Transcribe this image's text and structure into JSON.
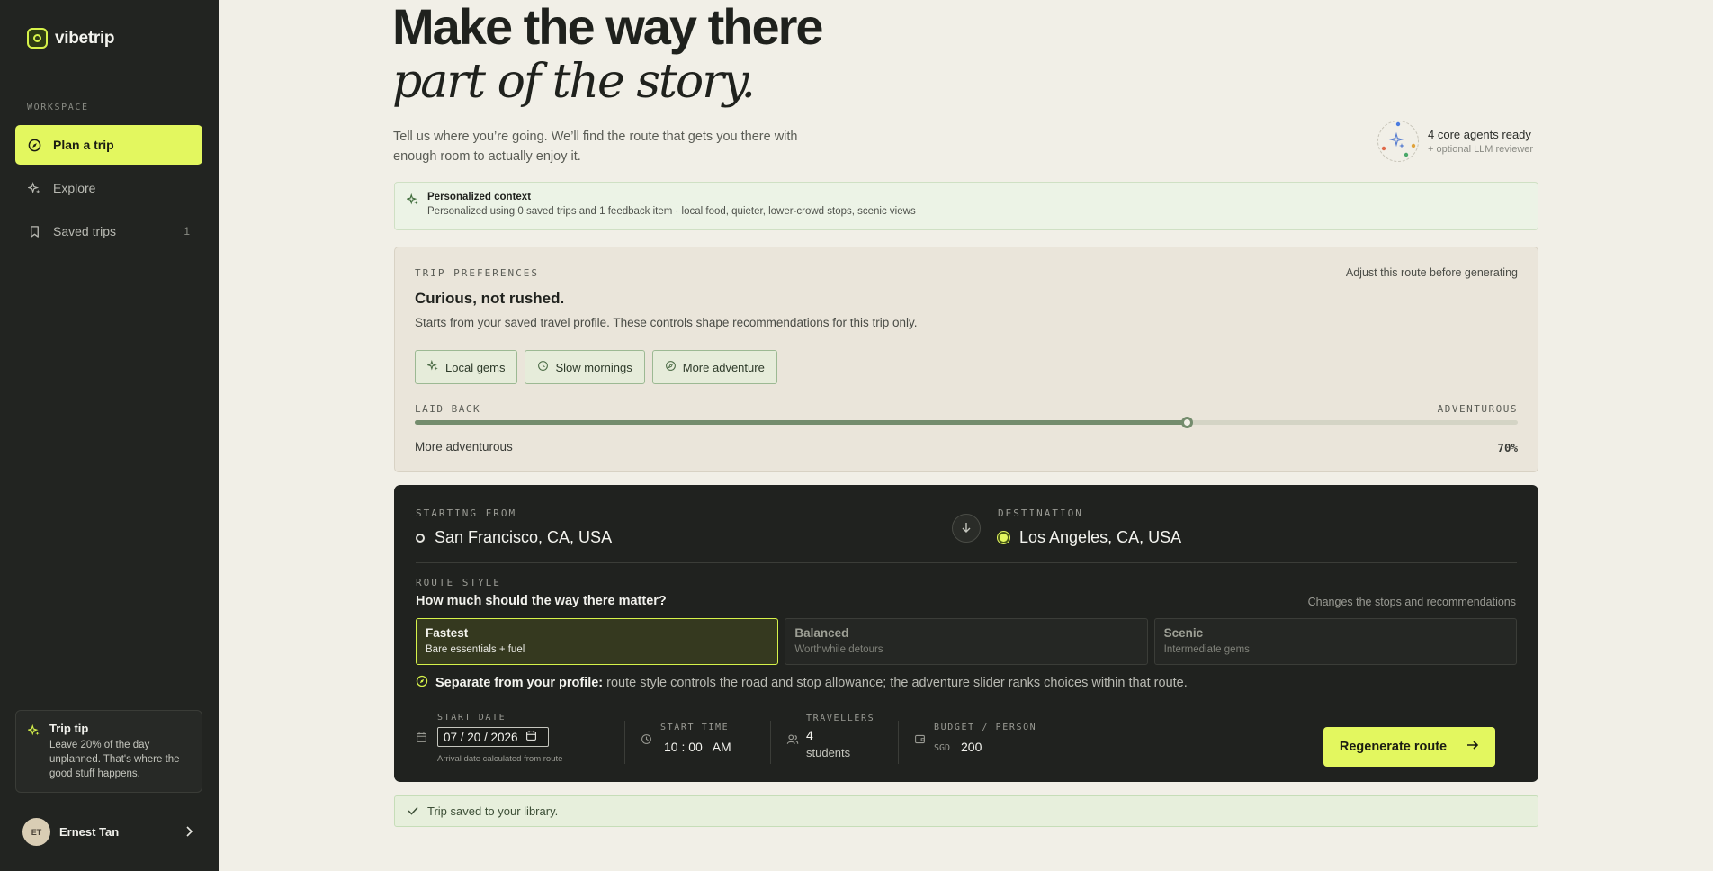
{
  "app": {
    "name": "vibetrip"
  },
  "sidebar": {
    "section_label": "WORKSPACE",
    "items": [
      {
        "label": "Plan a trip",
        "icon": "compass-icon",
        "active": true
      },
      {
        "label": "Explore",
        "icon": "sparkles-icon",
        "active": false
      },
      {
        "label": "Saved trips",
        "icon": "bookmark-icon",
        "active": false,
        "count": "1"
      }
    ],
    "tip": {
      "title": "Trip tip",
      "text": "Leave 20% of the day unplanned. That's where the good stuff happens."
    },
    "user": {
      "initials": "ET",
      "name": "Ernest Tan"
    }
  },
  "hero": {
    "line1": "Make the way there",
    "line2": "part of the story.",
    "intro": "Tell us where you’re going. We’ll find the route that gets you there with enough room to actually enjoy it."
  },
  "agents": {
    "title": "4 core agents ready",
    "subtitle": "+ optional LLM reviewer"
  },
  "context": {
    "title": "Personalized context",
    "text": "Personalized using 0 saved trips and 1 feedback item · local food, quieter, lower-crowd stops, scenic views"
  },
  "prefs": {
    "label": "TRIP PREFERENCES",
    "adjust": "Adjust this route before generating",
    "title": "Curious, not rushed.",
    "desc": "Starts from your saved travel profile. These controls shape recommendations for this trip only.",
    "chips": [
      {
        "label": "Local gems",
        "icon": "sparkles-icon"
      },
      {
        "label": "Slow mornings",
        "icon": "clock-icon"
      },
      {
        "label": "More adventure",
        "icon": "compass-icon"
      }
    ],
    "slider": {
      "left_label": "LAID BACK",
      "right_label": "ADVENTUROUS",
      "value": 0.7,
      "desc": "More adventurous",
      "percent": "70%"
    }
  },
  "route": {
    "from_label": "STARTING FROM",
    "from": "San Francisco, CA, USA",
    "to_label": "DESTINATION",
    "to": "Los Angeles, CA, USA",
    "style_label": "ROUTE STYLE",
    "style_question": "How much should the way there matter?",
    "style_note": "Changes the stops and recommendations",
    "options": [
      {
        "title": "Fastest",
        "subtitle": "Bare essentials + fuel",
        "selected": true
      },
      {
        "title": "Balanced",
        "subtitle": "Worthwhile detours",
        "selected": false
      },
      {
        "title": "Scenic",
        "subtitle": "Intermediate gems",
        "selected": false
      }
    ],
    "note_bold": "Separate from your profile:",
    "note_text": " route style controls the road and stop allowance; the adventure slider ranks choices within that route.",
    "start_date_label": "START DATE",
    "start_date": "07 / 20 / 2026",
    "start_date_sub": "Arrival date calculated from route",
    "start_time_label": "START TIME",
    "start_time": "10 : 00   AM",
    "travellers_label": "TRAVELLERS",
    "travellers_count": "4",
    "travellers_unit": "students",
    "budget_label": "BUDGET / PERSON",
    "budget_currency": "SGD",
    "budget_value": "200",
    "cta": "Regenerate route"
  },
  "toast": {
    "text": "Trip saved to your library."
  },
  "colors": {
    "accent": "#e3f75f",
    "sidebar": "#222421",
    "background": "#f1efe7",
    "route_panel": "#20221f"
  }
}
